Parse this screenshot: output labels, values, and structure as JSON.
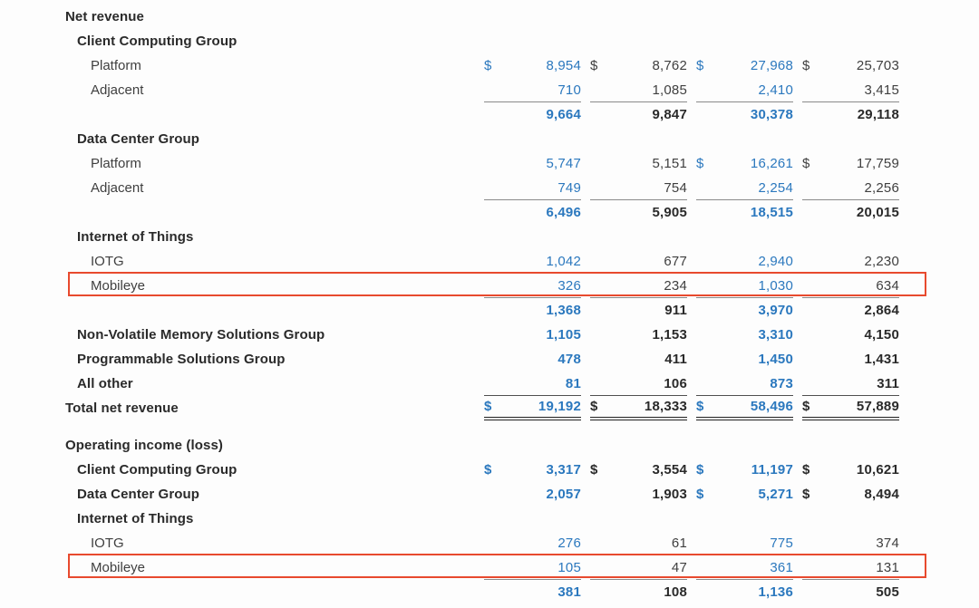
{
  "colors": {
    "page_bg": "#fdfdfd",
    "blue": "#2b78be",
    "dark_text": "#3f3f3f",
    "bold_text": "#2a2a2a",
    "rule_gray": "#8a8a8a",
    "rule_dark": "#4f4f4f",
    "rule_double": "#222222",
    "highlight_border": "#e84a2e"
  },
  "table": {
    "column_style": [
      "blue",
      "dark",
      "blue",
      "dark"
    ],
    "rows": [
      {
        "id": "net-revenue-header",
        "label": "Net revenue",
        "indent": 0,
        "bold": true
      },
      {
        "id": "ccg-header",
        "label": "Client Computing Group",
        "indent": 1,
        "bold": true
      },
      {
        "id": "ccg-platform",
        "label": "Platform",
        "indent": 2,
        "cells": [
          {
            "dollar": "$",
            "value": "8,954"
          },
          {
            "dollar": "$",
            "value": "8,762"
          },
          {
            "dollar": "$",
            "value": "27,968"
          },
          {
            "dollar": "$",
            "value": "25,703"
          }
        ]
      },
      {
        "id": "ccg-adjacent",
        "label": "Adjacent",
        "indent": 2,
        "rule": "gray",
        "cells": [
          {
            "dollar": "",
            "value": "710"
          },
          {
            "dollar": "",
            "value": "1,085"
          },
          {
            "dollar": "",
            "value": "2,410"
          },
          {
            "dollar": "",
            "value": "3,415"
          }
        ]
      },
      {
        "id": "ccg-subtotal",
        "label": "",
        "bold_values": true,
        "cells": [
          {
            "dollar": "",
            "value": "9,664"
          },
          {
            "dollar": "",
            "value": "9,847"
          },
          {
            "dollar": "",
            "value": "30,378"
          },
          {
            "dollar": "",
            "value": "29,118"
          }
        ]
      },
      {
        "id": "dcg-header",
        "label": "Data Center Group",
        "indent": 1,
        "bold": true
      },
      {
        "id": "dcg-platform",
        "label": "Platform",
        "indent": 2,
        "cells": [
          {
            "dollar": "",
            "value": "5,747"
          },
          {
            "dollar": "",
            "value": "5,151"
          },
          {
            "dollar": "$",
            "value": "16,261"
          },
          {
            "dollar": "$",
            "value": "17,759"
          }
        ]
      },
      {
        "id": "dcg-adjacent",
        "label": "Adjacent",
        "indent": 2,
        "rule": "gray",
        "cells": [
          {
            "dollar": "",
            "value": "749"
          },
          {
            "dollar": "",
            "value": "754"
          },
          {
            "dollar": "",
            "value": "2,254"
          },
          {
            "dollar": "",
            "value": "2,256"
          }
        ]
      },
      {
        "id": "dcg-subtotal",
        "label": "",
        "bold_values": true,
        "cells": [
          {
            "dollar": "",
            "value": "6,496"
          },
          {
            "dollar": "",
            "value": "5,905"
          },
          {
            "dollar": "",
            "value": "18,515"
          },
          {
            "dollar": "",
            "value": "20,015"
          }
        ]
      },
      {
        "id": "iot-header",
        "label": "Internet of Things",
        "indent": 1,
        "bold": true
      },
      {
        "id": "iot-iotg",
        "label": "IOTG",
        "indent": 2,
        "cells": [
          {
            "dollar": "",
            "value": "1,042"
          },
          {
            "dollar": "",
            "value": "677"
          },
          {
            "dollar": "",
            "value": "2,940"
          },
          {
            "dollar": "",
            "value": "2,230"
          }
        ]
      },
      {
        "id": "iot-mobileye",
        "label": "Mobileye",
        "indent": 2,
        "rule": "gray",
        "highlight": true,
        "cells": [
          {
            "dollar": "",
            "value": "326"
          },
          {
            "dollar": "",
            "value": "234"
          },
          {
            "dollar": "",
            "value": "1,030"
          },
          {
            "dollar": "",
            "value": "634"
          }
        ]
      },
      {
        "id": "iot-subtotal",
        "label": "",
        "bold_values": true,
        "cells": [
          {
            "dollar": "",
            "value": "1,368"
          },
          {
            "dollar": "",
            "value": "911"
          },
          {
            "dollar": "",
            "value": "3,970"
          },
          {
            "dollar": "",
            "value": "2,864"
          }
        ]
      },
      {
        "id": "nvm-group",
        "label": "Non-Volatile Memory Solutions Group",
        "indent": 1,
        "bold": true,
        "bold_values": true,
        "cells": [
          {
            "dollar": "",
            "value": "1,105"
          },
          {
            "dollar": "",
            "value": "1,153"
          },
          {
            "dollar": "",
            "value": "3,310"
          },
          {
            "dollar": "",
            "value": "4,150"
          }
        ]
      },
      {
        "id": "psg-group",
        "label": "Programmable Solutions Group",
        "indent": 1,
        "bold": true,
        "bold_values": true,
        "cells": [
          {
            "dollar": "",
            "value": "478"
          },
          {
            "dollar": "",
            "value": "411"
          },
          {
            "dollar": "",
            "value": "1,450"
          },
          {
            "dollar": "",
            "value": "1,431"
          }
        ]
      },
      {
        "id": "all-other",
        "label": "All other",
        "indent": 1,
        "bold": true,
        "bold_values": true,
        "rule": "dark",
        "cells": [
          {
            "dollar": "",
            "value": "81"
          },
          {
            "dollar": "",
            "value": "106"
          },
          {
            "dollar": "",
            "value": "873"
          },
          {
            "dollar": "",
            "value": "311"
          }
        ]
      },
      {
        "id": "total-net-revenue",
        "label": "Total net revenue",
        "indent": 0,
        "bold": true,
        "bold_values": true,
        "double_rule": true,
        "cells": [
          {
            "dollar": "$",
            "value": "19,192"
          },
          {
            "dollar": "$",
            "value": "18,333"
          },
          {
            "dollar": "$",
            "value": "58,496"
          },
          {
            "dollar": "$",
            "value": "57,889"
          }
        ]
      },
      {
        "id": "operating-income-header",
        "label": "Operating income (loss)",
        "indent": 0,
        "bold": true,
        "spacer_before": true
      },
      {
        "id": "oi-ccg",
        "label": "Client Computing Group",
        "indent": 1,
        "bold": true,
        "bold_values": true,
        "cells": [
          {
            "dollar": "$",
            "value": "3,317"
          },
          {
            "dollar": "$",
            "value": "3,554"
          },
          {
            "dollar": "$",
            "value": "11,197"
          },
          {
            "dollar": "$",
            "value": "10,621"
          }
        ]
      },
      {
        "id": "oi-dcg",
        "label": "Data Center Group",
        "indent": 1,
        "bold": true,
        "bold_values": true,
        "cells": [
          {
            "dollar": "",
            "value": "2,057"
          },
          {
            "dollar": "",
            "value": "1,903"
          },
          {
            "dollar": "$",
            "value": "5,271"
          },
          {
            "dollar": "$",
            "value": "8,494"
          }
        ]
      },
      {
        "id": "oi-iot-header",
        "label": "Internet of Things",
        "indent": 1,
        "bold": true
      },
      {
        "id": "oi-iotg",
        "label": "IOTG",
        "indent": 2,
        "cells": [
          {
            "dollar": "",
            "value": "276"
          },
          {
            "dollar": "",
            "value": "61"
          },
          {
            "dollar": "",
            "value": "775"
          },
          {
            "dollar": "",
            "value": "374"
          }
        ]
      },
      {
        "id": "oi-mobileye",
        "label": "Mobileye",
        "indent": 2,
        "rule": "gray",
        "highlight": true,
        "cells": [
          {
            "dollar": "",
            "value": "105"
          },
          {
            "dollar": "",
            "value": "47"
          },
          {
            "dollar": "",
            "value": "361"
          },
          {
            "dollar": "",
            "value": "131"
          }
        ]
      },
      {
        "id": "oi-subtotal",
        "label": "",
        "bold_values": true,
        "cells": [
          {
            "dollar": "",
            "value": "381"
          },
          {
            "dollar": "",
            "value": "108"
          },
          {
            "dollar": "",
            "value": "1,136"
          },
          {
            "dollar": "",
            "value": "505"
          }
        ]
      }
    ]
  }
}
